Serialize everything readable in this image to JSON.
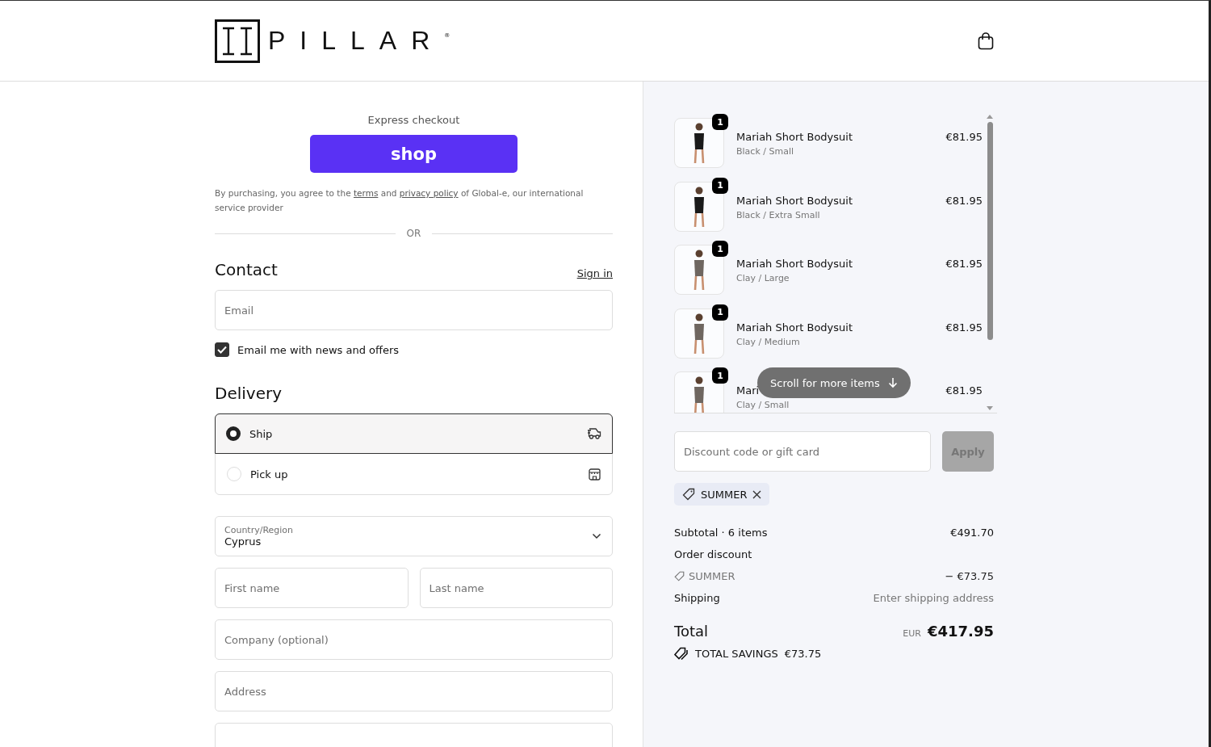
{
  "header": {
    "logo": {
      "text": "PILLAR",
      "mark": "®"
    }
  },
  "express": {
    "title": "Express checkout",
    "button": "shop",
    "legal": [
      {
        "kind": "text",
        "text": "By purchasing, you agree to the "
      },
      {
        "kind": "link",
        "text": "terms"
      },
      {
        "kind": "text",
        "text": " and "
      },
      {
        "kind": "link",
        "text": "privacy policy"
      },
      {
        "kind": "text",
        "text": " of Global-e, our international service provider"
      }
    ],
    "separator": "OR"
  },
  "contact": {
    "title": "Contact",
    "sign_in": "Sign in",
    "email": {
      "placeholder": "Email"
    },
    "newsletter": {
      "label": "Email me with news and offers",
      "checked": true
    }
  },
  "delivery": {
    "title": "Delivery",
    "options": [
      {
        "label": "Ship",
        "selected": true,
        "kind": "ship"
      },
      {
        "label": "Pick up",
        "selected": false,
        "kind": "pickup"
      }
    ],
    "country": {
      "label": "Country/Region",
      "value": "Cyprus"
    },
    "fields": [
      {
        "placeholder": "First name",
        "kind": "half"
      },
      {
        "placeholder": "Last name",
        "kind": "half"
      },
      {
        "placeholder": "Company (optional)",
        "kind": "full"
      },
      {
        "placeholder": "Address",
        "kind": "full"
      },
      {
        "kind": "full"
      }
    ]
  },
  "cart": {
    "items": [
      {
        "name": "Mariah Short Bodysuit",
        "variant": "Black / Small",
        "price": "€81.95",
        "quantity": "1",
        "color": "#1a1a1a"
      },
      {
        "name": "Mariah Short Bodysuit",
        "variant": "Black / Extra Small",
        "price": "€81.95",
        "quantity": "1",
        "color": "#1a1a1a"
      },
      {
        "name": "Mariah Short Bodysuit",
        "variant": "Clay / Large",
        "price": "€81.95",
        "quantity": "1",
        "color": "#6e6660"
      },
      {
        "name": "Mariah Short Bodysuit",
        "variant": "Clay / Medium",
        "price": "€81.95",
        "quantity": "1",
        "color": "#6e6660"
      },
      {
        "name": "Mari",
        "variant": "Clay / Small",
        "price": "€81.95",
        "quantity": "1",
        "color": "#6e6660"
      }
    ],
    "scroll_hint": "Scroll for more items"
  },
  "discount": {
    "placeholder": "Discount code or gift card",
    "apply": "Apply",
    "apply_disabled": true,
    "applied_code": "SUMMER"
  },
  "summary": {
    "subtotal_label": "Subtotal · 6 items",
    "subtotal": "€491.70",
    "discount_label": "Order discount",
    "discount_code": "SUMMER",
    "discount": "− €73.75",
    "shipping_label": "Shipping",
    "shipping": "Enter shipping address",
    "total_label": "Total",
    "currency": "EUR",
    "total": "€417.95",
    "savings_label": "TOTAL SAVINGS",
    "savings": "€73.75"
  }
}
